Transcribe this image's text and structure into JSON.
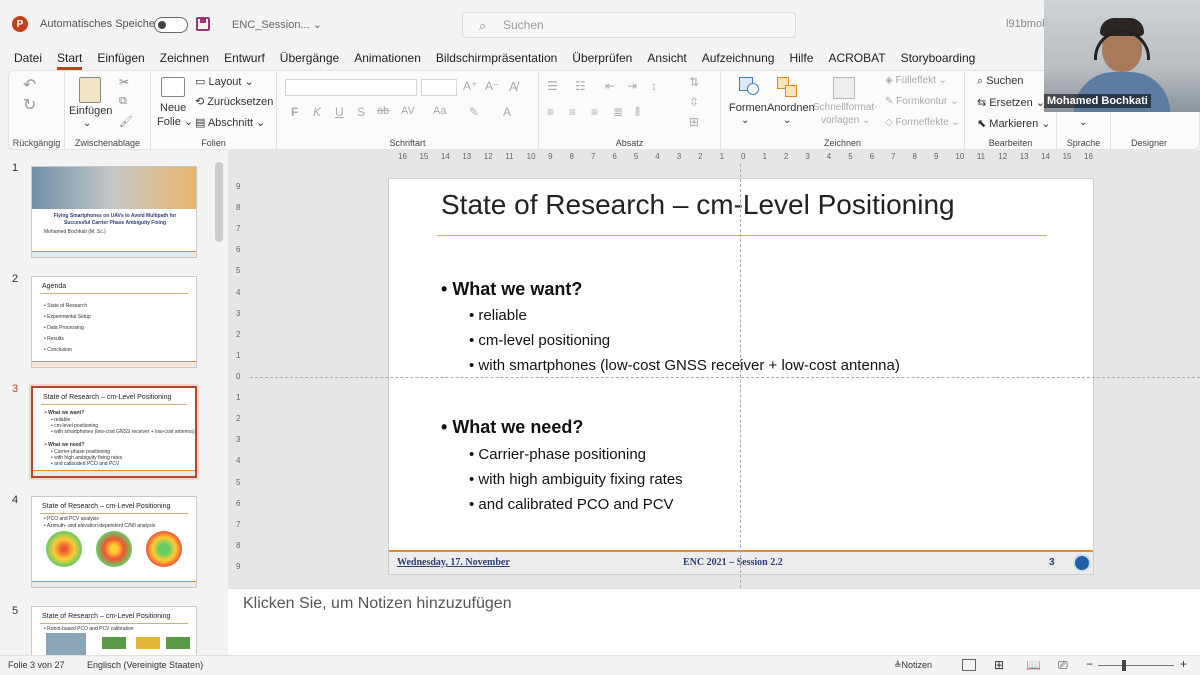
{
  "titlebar": {
    "app_letter": "P",
    "autosave_label": "Automatisches Speichern",
    "filename": "ENC_Session...",
    "search_placeholder": "Suchen",
    "user_id": "l91bmob"
  },
  "video": {
    "participant_name": "Mohamed Bochkati"
  },
  "menu_tabs": [
    "Datei",
    "Start",
    "Einfügen",
    "Zeichnen",
    "Entwurf",
    "Übergänge",
    "Animationen",
    "Bildschirmpräsentation",
    "Überprüfen",
    "Ansicht",
    "Aufzeichnung",
    "Hilfe",
    "ACROBAT",
    "Storyboarding"
  ],
  "active_tab": "Start",
  "ribbon": {
    "groups": {
      "undo": "Rückgängig",
      "clipboard": "Zwischenablage",
      "slides": "Folien",
      "font": "Schriftart",
      "paragraph": "Absatz",
      "drawing": "Zeichnen",
      "editing": "Bearbeiten",
      "language": "Sprache",
      "designer": "Designer"
    },
    "paste_label": "Einfügen",
    "new_slide_label_1": "Neue",
    "new_slide_label_2": "Folie",
    "layout_label": "Layout",
    "reset_label": "Zurücksetzen",
    "section_label": "Abschnitt",
    "shapes_label": "Formen",
    "arrange_label": "Anordnen",
    "quickstyles_label_1": "Schnellformat-",
    "quickstyles_label_2": "vorlagen",
    "fill_label": "Fülleffekt",
    "outline_label": "Formkontur",
    "effects_label": "Formeffekte",
    "find_label": "Suchen",
    "replace_label": "Ersetzen",
    "select_label": "Markieren",
    "font_buttons": [
      "F",
      "K",
      "U",
      "S"
    ]
  },
  "thumbnails": [
    {
      "number": "1",
      "title": "Flying Smartphones on UAVs to Avoid Multipath for Successful Carrier Phase Ambiguity Fixing",
      "author": "Mohamed Bochkati (M. Sc.)"
    },
    {
      "number": "2",
      "title": "Agenda",
      "bullets": [
        "State of Research",
        "Experimental Setup",
        "Data Processing",
        "Results",
        "Conclusion"
      ]
    },
    {
      "number": "3",
      "title": "State of Research – cm-Level Positioning",
      "bullets": [
        "What we want?",
        "reliable",
        "cm-level positioning",
        "with smartphones (low-cost GNSS receiver + low-cost antenna)",
        "What we need?",
        "Carrier-phase positioning",
        "with high ambiguity fixing rates",
        "and calibrated PCO and PCV"
      ]
    },
    {
      "number": "4",
      "title": "State of Research – cm-Level Positioning",
      "bullets": [
        "PCO and PCV analysis",
        "Azimuth- and elevation-dependent C/N0 analysis"
      ]
    },
    {
      "number": "5",
      "title": "State of Research – cm-Level Positioning",
      "bullets": [
        "Robot-based PCO and PCV calibration"
      ]
    }
  ],
  "ruler": {
    "h_labels": [
      "16",
      "15",
      "14",
      "13",
      "12",
      "11",
      "10",
      "9",
      "8",
      "7",
      "6",
      "5",
      "4",
      "3",
      "2",
      "1",
      "0",
      "1",
      "2",
      "3",
      "4",
      "5",
      "6",
      "7",
      "8",
      "9",
      "10",
      "11",
      "12",
      "13",
      "14",
      "15",
      "16"
    ],
    "v_labels": [
      "9",
      "8",
      "7",
      "6",
      "5",
      "4",
      "3",
      "2",
      "1",
      "0",
      "1",
      "2",
      "3",
      "4",
      "5",
      "6",
      "7",
      "8",
      "9"
    ]
  },
  "slide": {
    "title": "State of Research – cm-Level Positioning",
    "section1": "What we want?",
    "items1": [
      "reliable",
      "cm-level positioning",
      "with smartphones (low-cost GNSS  receiver + low-cost antenna)"
    ],
    "section2": "What we need?",
    "items2": [
      "Carrier-phase positioning",
      "with high ambiguity fixing rates",
      "and calibrated PCO and PCV"
    ],
    "footer_date": "Wednesday, 17. November",
    "footer_session": "ENC 2021 – Session 2.2",
    "footer_number": "3",
    "accent_color": "#e58b2b",
    "footer_text_color": "#2c3f7a"
  },
  "notes": {
    "placeholder": "Klicken Sie, um Notizen hinzuzufügen"
  },
  "statusbar": {
    "slide_count": "Folie 3 von 27",
    "language": "Englisch (Vereinigte Staaten)",
    "notes_label": "Notizen"
  }
}
